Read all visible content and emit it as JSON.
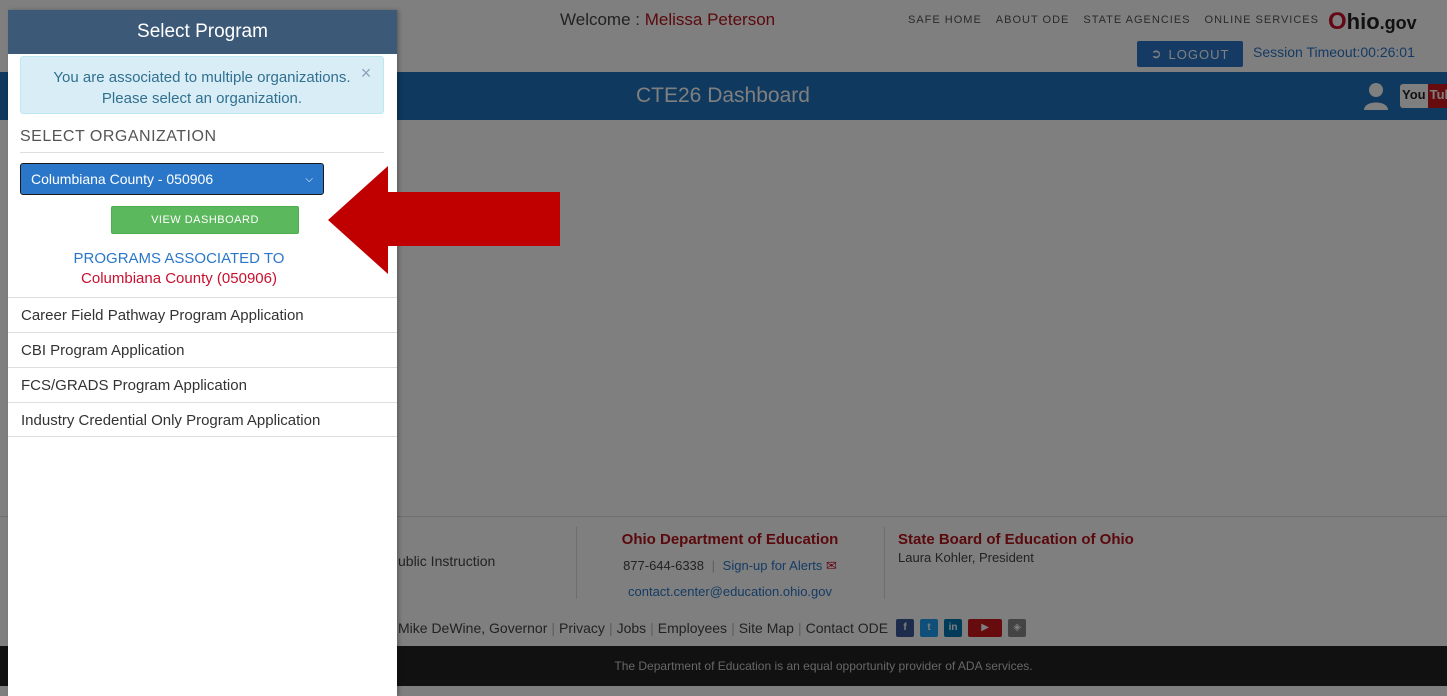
{
  "header": {
    "welcome_label": "Welcome :",
    "user_name": "Melissa Peterson",
    "links": [
      "SAFE HOME",
      "ABOUT ODE",
      "STATE AGENCIES",
      "ONLINE SERVICES"
    ],
    "logo_o": "O",
    "logo_hio": "hio",
    "logo_gov": ".gov",
    "logout_label": "LOGOUT",
    "session_timeout": "Session Timeout:00:26:01"
  },
  "navbar": {
    "title": "CTE26 Dashboard",
    "youtube_you": "You",
    "youtube_tube": "Tube"
  },
  "footer": {
    "col1_text": "ublic Instruction",
    "ode_title": "Ohio Department of Education",
    "phone": "877-644-6338",
    "alerts_link": "Sign-up for Alerts",
    "email": "contact.center@education.ohio.gov",
    "board_title": "State Board of Education of Ohio",
    "board_president": "Laura Kohler, President",
    "bottom_links": [
      "Mike DeWine, Governor",
      "Privacy",
      "Jobs",
      "Employees",
      "Site Map",
      "Contact ODE"
    ],
    "ada_notice": "The Department of Education is an equal opportunity provider of ADA services."
  },
  "panel": {
    "title": "Select Program",
    "alert_line1": "You are associated to multiple organizations.",
    "alert_line2": "Please select an organization.",
    "section_title": "SELECT ORGANIZATION",
    "selected_org": "Columbiana County - 050906",
    "view_button": "VIEW DASHBOARD",
    "assoc_label": "PROGRAMS ASSOCIATED TO",
    "assoc_org": "Columbiana County (050906)",
    "programs": [
      "Career Field Pathway Program Application",
      "CBI Program Application",
      "FCS/GRADS Program Application",
      "Industry Credential Only Program Application"
    ]
  },
  "colors": {
    "panel_header": "#3c5a78",
    "primary_blue": "#2a77c9",
    "success_green": "#5cb85c",
    "arrow_red": "#c00000",
    "ode_red": "#b5121b"
  }
}
